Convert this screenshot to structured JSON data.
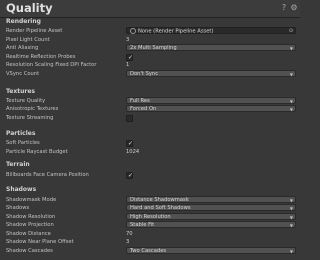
{
  "header": {
    "title": "Quality",
    "help_icon": "help-icon",
    "settings_icon": "settings-icon"
  },
  "sections": {
    "rendering": "Rendering",
    "textures": "Textures",
    "particles": "Particles",
    "terrain": "Terrain",
    "shadows": "Shadows"
  },
  "rendering": {
    "pipeline_asset_label": "Render Pipeline Asset",
    "pipeline_asset_value": "None (Render Pipeline Asset)",
    "pixel_light_label": "Pixel Light Count",
    "pixel_light_value": "3",
    "aa_label": "Anti Aliasing",
    "aa_value": "2x Multi Sampling",
    "reflection_label": "Realtime Reflection Probes",
    "reflection_checked": true,
    "dpi_label": "Resolution Scaling Fixed DPI Factor",
    "dpi_value": "1",
    "vsync_label": "VSync Count",
    "vsync_value": "Don't Sync"
  },
  "textures": {
    "quality_label": "Texture Quality",
    "quality_value": "Full Res",
    "aniso_label": "Anisotropic Textures",
    "aniso_value": "Forced On",
    "streaming_label": "Texture Streaming",
    "streaming_checked": false
  },
  "particles": {
    "soft_label": "Soft Particles",
    "soft_checked": true,
    "raycast_label": "Particle Raycast Budget",
    "raycast_value": "1024"
  },
  "terrain": {
    "billboards_label": "Billboards Face Camera Position",
    "billboards_checked": true
  },
  "shadows": {
    "mask_label": "Shadowmask Mode",
    "mask_value": "Distance Shadowmask",
    "shadows_label": "Shadows",
    "shadows_value": "Hard and Soft Shadows",
    "resolution_label": "Shadow Resolution",
    "resolution_value": "High Resolution",
    "projection_label": "Shadow Projection",
    "projection_value": "Stable Fit",
    "distance_label": "Shadow Distance",
    "distance_value": "70",
    "offset_label": "Shadow Near Plane Offset",
    "offset_value": "3",
    "cascades_label": "Shadow Cascades",
    "cascades_value": "Two Cascades"
  },
  "check_glyph": "✓",
  "dropdown_arrow": "▼",
  "picker_glyph": "⊙"
}
